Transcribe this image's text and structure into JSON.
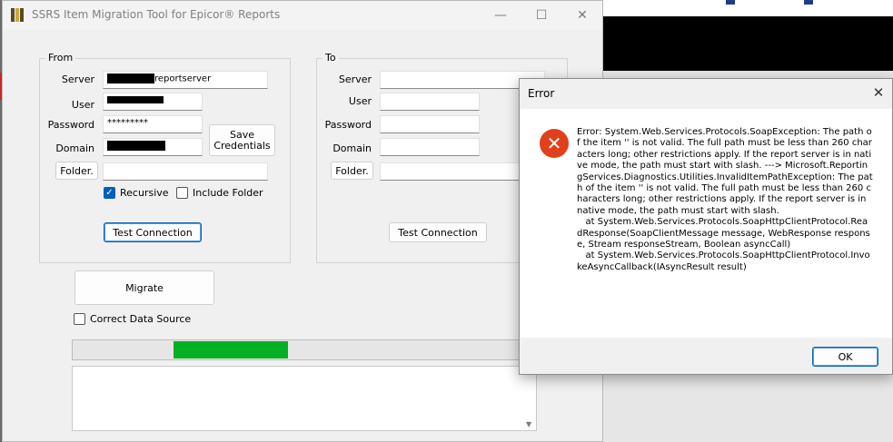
{
  "window": {
    "title": "SSRS Item Migration Tool for Epicor® Reports"
  },
  "from": {
    "group_label": "From",
    "server_label": "Server",
    "server_value": "reportserver",
    "user_label": "User",
    "password_label": "Password",
    "password_value": "*********",
    "domain_label": "Domain",
    "domain_value": "L",
    "folder_button": "Folder.",
    "save_button": "Save\nCredentials",
    "recursive_label": "Recursive",
    "recursive_checked": true,
    "include_folder_label": "Include Folder",
    "include_folder_checked": false,
    "test_button": "Test Connection"
  },
  "to": {
    "group_label": "To",
    "server_label": "Server",
    "user_label": "User",
    "password_label": "Password",
    "domain_label": "Domain",
    "folder_button": "Folder.",
    "test_button": "Test Connection"
  },
  "actions": {
    "migrate_button": "Migrate",
    "correct_ds_label": "Correct Data Source",
    "correct_ds_checked": false
  },
  "progress": {
    "fill_start": 0.22,
    "fill_end": 0.47,
    "color": "#06b025"
  },
  "dialog": {
    "title": "Error",
    "message": "Error: System.Web.Services.Protocols.SoapException: The path of the item '' is not valid. The full path must be less than 260 characters long; other restrictions apply. If the report server is in native mode, the path must start with slash. ---> Microsoft.ReportingServices.Diagnostics.Utilities.InvalidItemPathException: The path of the item '' is not valid. The full path must be less than 260 characters long; other restrictions apply. If the report server is in native mode, the path must start with slash.\n   at System.Web.Services.Protocols.SoapHttpClientProtocol.ReadResponse(SoapClientMessage message, WebResponse response, Stream responseStream, Boolean asyncCall)\n   at System.Web.Services.Protocols.SoapHttpClientProtocol.InvokeAsyncCallback(IAsyncResult result)",
    "ok_button": "OK",
    "icon": "error-icon"
  },
  "colors": {
    "accent": "#0067c0",
    "error": "#e0401c"
  }
}
